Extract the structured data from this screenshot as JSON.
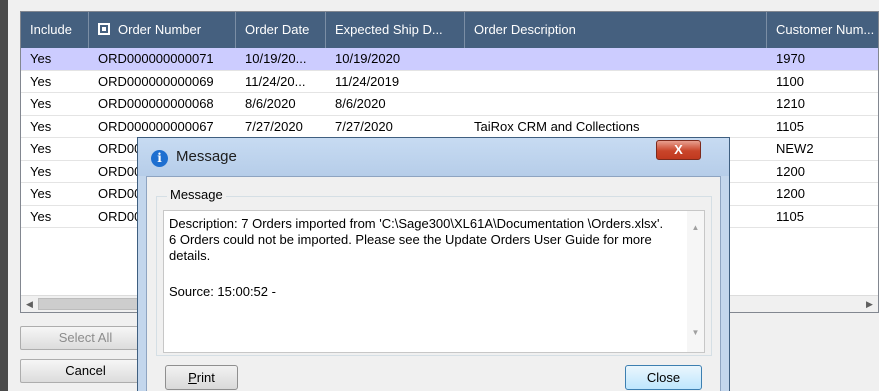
{
  "grid": {
    "columns": [
      {
        "label": "Include",
        "has_icon": false
      },
      {
        "label": "Order Number",
        "has_icon": true
      },
      {
        "label": "Order Date",
        "has_icon": false
      },
      {
        "label": "Expected Ship D...",
        "has_icon": false
      },
      {
        "label": "Order Description",
        "has_icon": false
      },
      {
        "label": "Customer Num...",
        "has_icon": false
      }
    ],
    "rows": [
      {
        "include": "Yes",
        "order_number": "ORD000000000071",
        "order_date": "10/19/20...",
        "ship_date": "10/19/2020",
        "description": "",
        "customer": "1970",
        "selected": true
      },
      {
        "include": "Yes",
        "order_number": "ORD000000000069",
        "order_date": "11/24/20...",
        "ship_date": "11/24/2019",
        "description": "",
        "customer": "1100",
        "selected": false
      },
      {
        "include": "Yes",
        "order_number": "ORD000000000068",
        "order_date": "8/6/2020",
        "ship_date": "8/6/2020",
        "description": "",
        "customer": "1210",
        "selected": false
      },
      {
        "include": "Yes",
        "order_number": "ORD000000000067",
        "order_date": "7/27/2020",
        "ship_date": "7/27/2020",
        "description": "TaiRox CRM and Collections",
        "customer": "1105",
        "selected": false
      },
      {
        "include": "Yes",
        "order_number": "ORD00",
        "order_date": "",
        "ship_date": "",
        "description": "",
        "customer": "NEW2",
        "selected": false
      },
      {
        "include": "Yes",
        "order_number": "ORD00",
        "order_date": "",
        "ship_date": "",
        "description": "",
        "customer": "1200",
        "selected": false
      },
      {
        "include": "Yes",
        "order_number": "ORD00",
        "order_date": "",
        "ship_date": "",
        "description": "",
        "customer": "1200",
        "selected": false
      },
      {
        "include": "Yes",
        "order_number": "ORD00",
        "order_date": "",
        "ship_date": "",
        "description": "",
        "customer": "1105",
        "selected": false
      }
    ],
    "selected_row_color": "#ccccff",
    "header_color": "#45607f"
  },
  "buttons": {
    "select_all": "Select All",
    "cancel": "Cancel"
  },
  "dialog": {
    "title": "Message",
    "icon": "info-icon",
    "close_glyph": "X",
    "group_label": "Message",
    "description": "Description: 7 Orders imported from 'C:\\Sage300\\XL61A\\Documentation \\Orders.xlsx'. 6 Orders could not be imported. Please see the Update Orders User Guide for more details.",
    "source": "Source:  15:00:52 -",
    "print_first": "P",
    "print_rest": "rint",
    "close_label": "Close"
  }
}
